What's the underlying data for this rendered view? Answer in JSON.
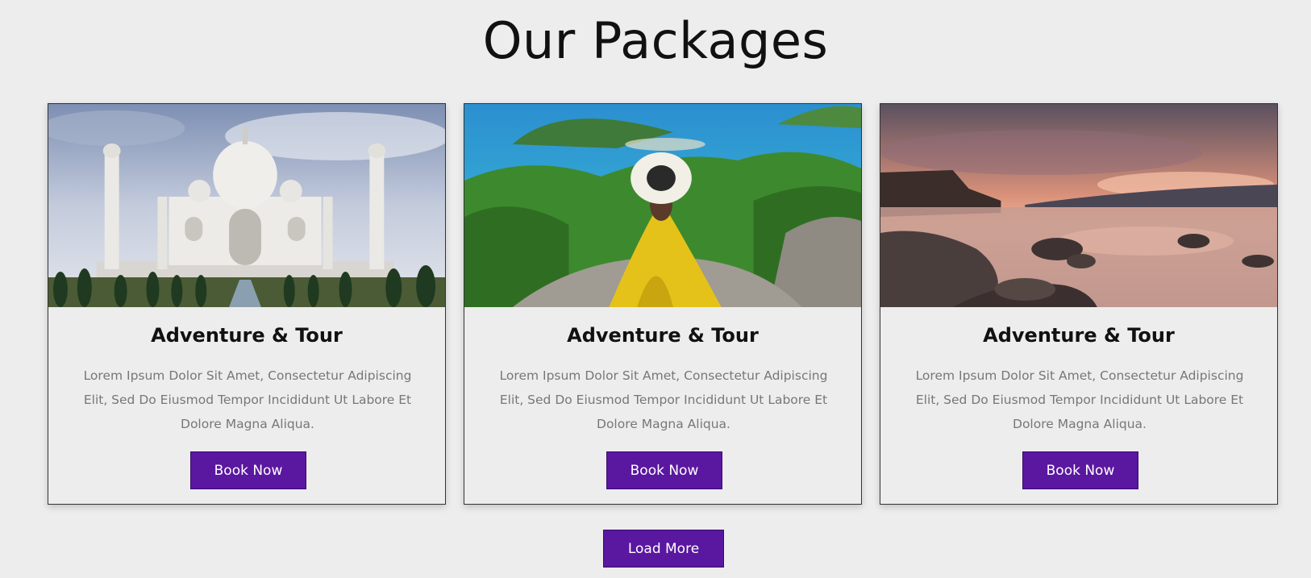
{
  "page": {
    "title": "Our Packages",
    "load_more_label": "Load More"
  },
  "packages": [
    {
      "image": "taj-mahal-image",
      "title": "Adventure & Tour",
      "description": "Lorem Ipsum Dolor Sit Amet, Consectetur Adipiscing Elit, Sed Do Eiusmod Tempor Incididunt Ut Labore Et Dolore Magna Aliqua.",
      "button_label": "Book Now"
    },
    {
      "image": "tropical-island-image",
      "title": "Adventure & Tour",
      "description": "Lorem Ipsum Dolor Sit Amet, Consectetur Adipiscing Elit, Sed Do Eiusmod Tempor Incididunt Ut Labore Et Dolore Magna Aliqua.",
      "button_label": "Book Now"
    },
    {
      "image": "sunset-lake-image",
      "title": "Adventure & Tour",
      "description": "Lorem Ipsum Dolor Sit Amet, Consectetur Adipiscing Elit, Sed Do Eiusmod Tempor Incididunt Ut Labore Et Dolore Magna Aliqua.",
      "button_label": "Book Now"
    }
  ],
  "colors": {
    "accent": "#5a17a0",
    "background": "#ededed"
  }
}
